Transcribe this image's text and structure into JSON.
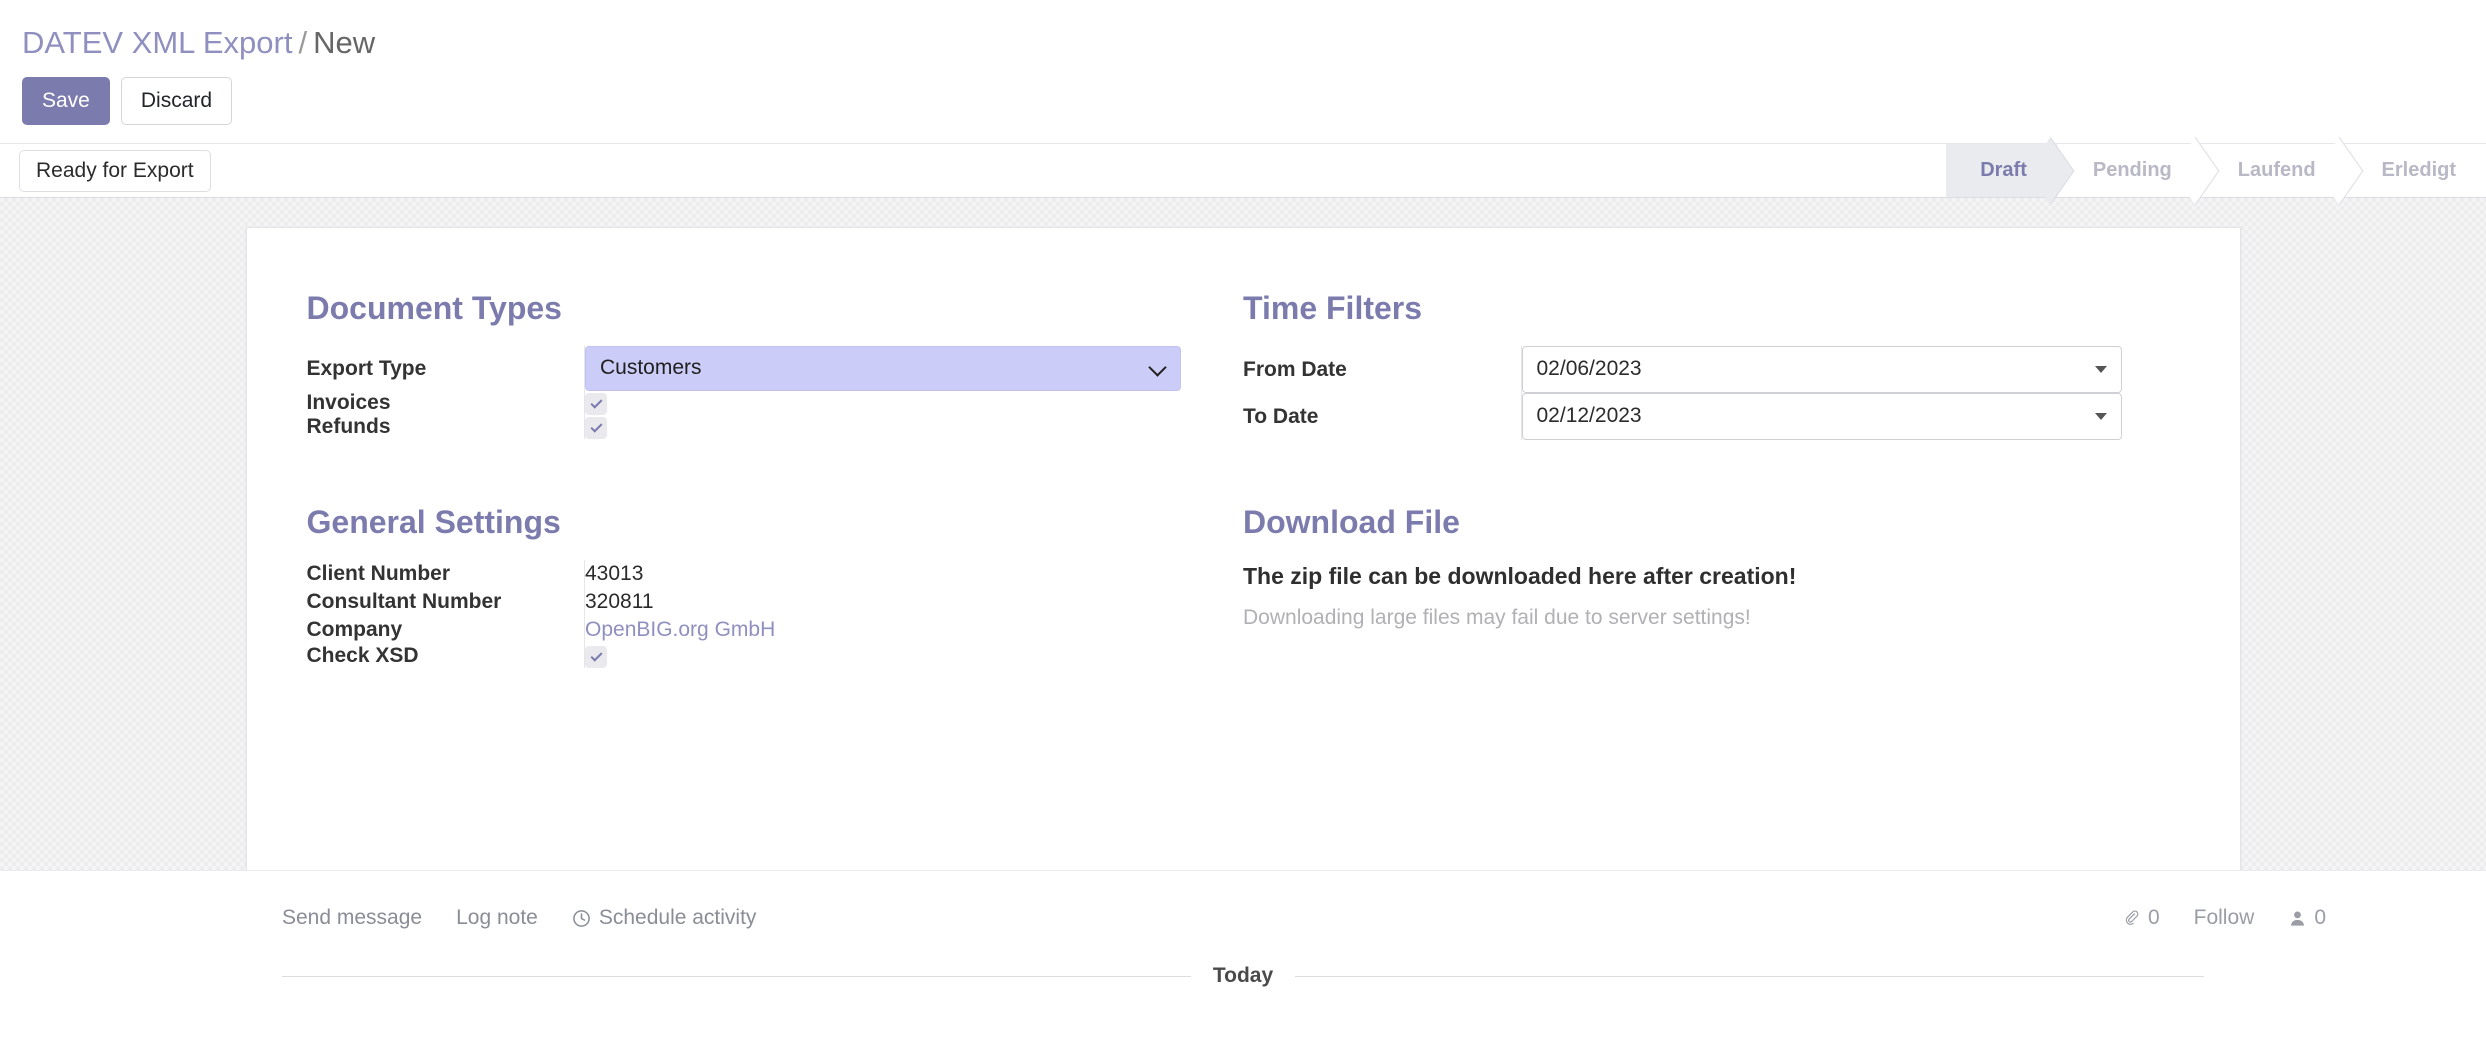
{
  "breadcrumb": {
    "root": "DATEV XML Export",
    "separator": "/",
    "current": "New"
  },
  "control_panel": {
    "save_label": "Save",
    "discard_label": "Discard"
  },
  "statusbar": {
    "stat_button_label": "Ready for Export",
    "steps": [
      {
        "label": "Draft",
        "active": true
      },
      {
        "label": "Pending",
        "active": false
      },
      {
        "label": "Laufend",
        "active": false
      },
      {
        "label": "Erledigt",
        "active": false
      }
    ]
  },
  "form": {
    "document_types": {
      "title": "Document Types",
      "export_type_label": "Export Type",
      "export_type_value": "Customers",
      "invoices_label": "Invoices",
      "invoices_checked": true,
      "refunds_label": "Refunds",
      "refunds_checked": true
    },
    "time_filters": {
      "title": "Time Filters",
      "from_date_label": "From Date",
      "from_date_value": "02/06/2023",
      "to_date_label": "To Date",
      "to_date_value": "02/12/2023"
    },
    "general_settings": {
      "title": "General Settings",
      "client_number_label": "Client Number",
      "client_number_value": "43013",
      "consultant_number_label": "Consultant Number",
      "consultant_number_value": "320811",
      "company_label": "Company",
      "company_value": "OpenBIG.org GmbH",
      "check_xsd_label": "Check XSD",
      "check_xsd_checked": true
    },
    "download_file": {
      "title": "Download File",
      "headline": "The zip file can be downloaded here after creation!",
      "subtext": "Downloading large files may fail due to server settings!"
    }
  },
  "chatter": {
    "send_message_label": "Send message",
    "log_note_label": "Log note",
    "schedule_activity_label": "Schedule activity",
    "attachment_count": "0",
    "follow_label": "Follow",
    "follower_count": "0",
    "today_label": "Today"
  },
  "colors": {
    "accent_purple": "#7c7bad",
    "link_purple": "#8f8fc0",
    "select_bg": "#ccccf9",
    "muted_gray": "#b8b8c6"
  }
}
